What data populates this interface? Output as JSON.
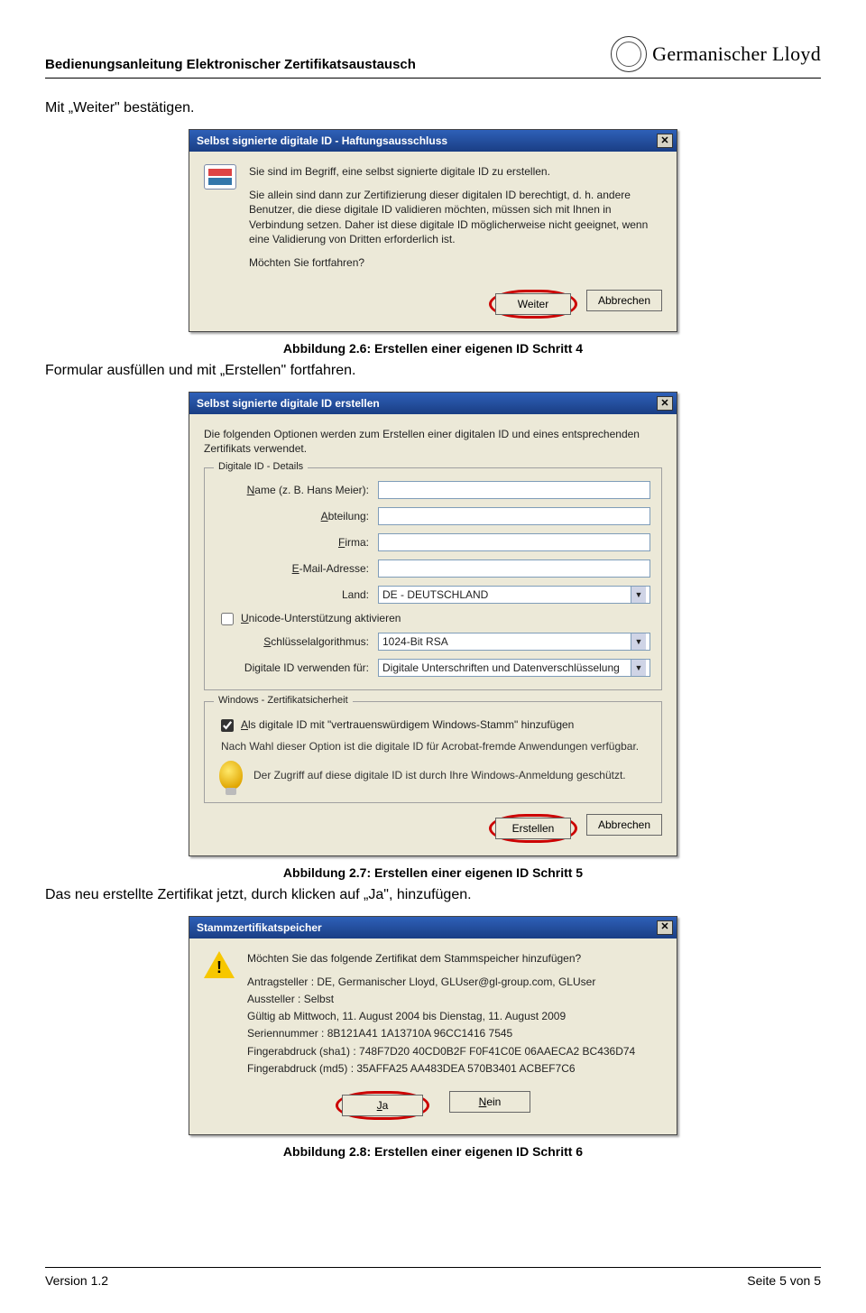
{
  "header": {
    "doc_title": "Bedienungsanleitung Elektronischer Zertifikatsaustausch",
    "brand": "Germanischer Lloyd"
  },
  "t1": "Mit „Weiter\" bestätigen.",
  "d1": {
    "title": "Selbst signierte digitale ID - Haftungsausschluss",
    "p1": "Sie sind im Begriff, eine selbst signierte digitale ID zu erstellen.",
    "p2": "Sie allein sind dann zur Zertifizierung dieser digitalen ID berechtigt, d. h. andere Benutzer, die diese digitale ID validieren möchten, müssen sich mit Ihnen in Verbindung setzen. Daher ist diese digitale ID möglicherweise nicht geeignet, wenn eine Validierung von Dritten erforderlich ist.",
    "p3": "Möchten Sie fortfahren?",
    "btn_weiter": "Weiter",
    "btn_abbrechen": "Abbrechen"
  },
  "cap1": "Abbildung 2.6: Erstellen einer eigenen ID Schritt 4",
  "t2": "Formular ausfüllen und mit „Erstellen\" fortfahren.",
  "d2": {
    "title": "Selbst signierte digitale ID erstellen",
    "intro": "Die folgenden Optionen werden zum Erstellen einer digitalen ID und eines entsprechenden Zertifikats verwendet.",
    "legend1": "Digitale ID - Details",
    "lbl_name_pre": "N",
    "lbl_name": "ame (z. B. Hans Meier):",
    "lbl_abteilung_pre": "A",
    "lbl_abteilung": "bteilung:",
    "lbl_firma_pre": "F",
    "lbl_firma": "irma:",
    "lbl_email_pre": "E",
    "lbl_email": "-Mail-Adresse:",
    "lbl_land": "Land:",
    "val_land": "DE - DEUTSCHLAND",
    "chk_unicode_pre": "U",
    "chk_unicode": "nicode-Unterstützung aktivieren",
    "lbl_algo_pre": "S",
    "lbl_algo": "chlüsselalgorithmus:",
    "val_algo": "1024-Bit RSA",
    "lbl_use": "Digitale ID verwenden für:",
    "val_use": "Digitale Unterschriften und Datenverschlüsselung",
    "legend2": "Windows - Zertifikatsicherheit",
    "chk_trust_pre": "A",
    "chk_trust": "ls digitale ID mit \"vertrauenswürdigem Windows-Stamm\" hinzufügen",
    "trust_note": "Nach Wahl dieser Option ist die digitale ID für Acrobat-fremde Anwendungen verfügbar.",
    "bulb_note": "Der Zugriff auf diese digitale ID ist durch Ihre Windows-Anmeldung geschützt.",
    "btn_erstellen": "Erstellen",
    "btn_abbrechen": "Abbrechen"
  },
  "cap2": "Abbildung 2.7: Erstellen einer eigenen ID Schritt 5",
  "t3": "Das neu erstellte Zertifikat jetzt, durch klicken auf „Ja\", hinzufügen.",
  "d3": {
    "title": "Stammzertifikatspeicher",
    "q": "Möchten Sie das folgende Zertifikat dem Stammspeicher hinzufügen?",
    "l1": "Antragsteller : DE, Germanischer Lloyd, GLUser@gl-group.com, GLUser",
    "l2": "Aussteller : Selbst",
    "l3": "Gültig ab Mittwoch, 11. August 2004 bis Dienstag, 11. August 2009",
    "l4": "Seriennummer : 8B121A41 1A13710A 96CC1416 7545",
    "l5": "Fingerabdruck (sha1) : 748F7D20 40CD0B2F F0F41C0E 06AAECA2 BC436D74",
    "l6": "Fingerabdruck (md5) : 35AFFA25 AA483DEA 570B3401 ACBEF7C6",
    "btn_ja": "Ja",
    "btn_nein": "Nein",
    "btn_ja_pre": "J",
    "btn_nein_pre": "N"
  },
  "cap3": "Abbildung 2.8: Erstellen einer eigenen ID Schritt 6",
  "footer": {
    "left": "Version 1.2",
    "right": "Seite 5 von 5"
  }
}
